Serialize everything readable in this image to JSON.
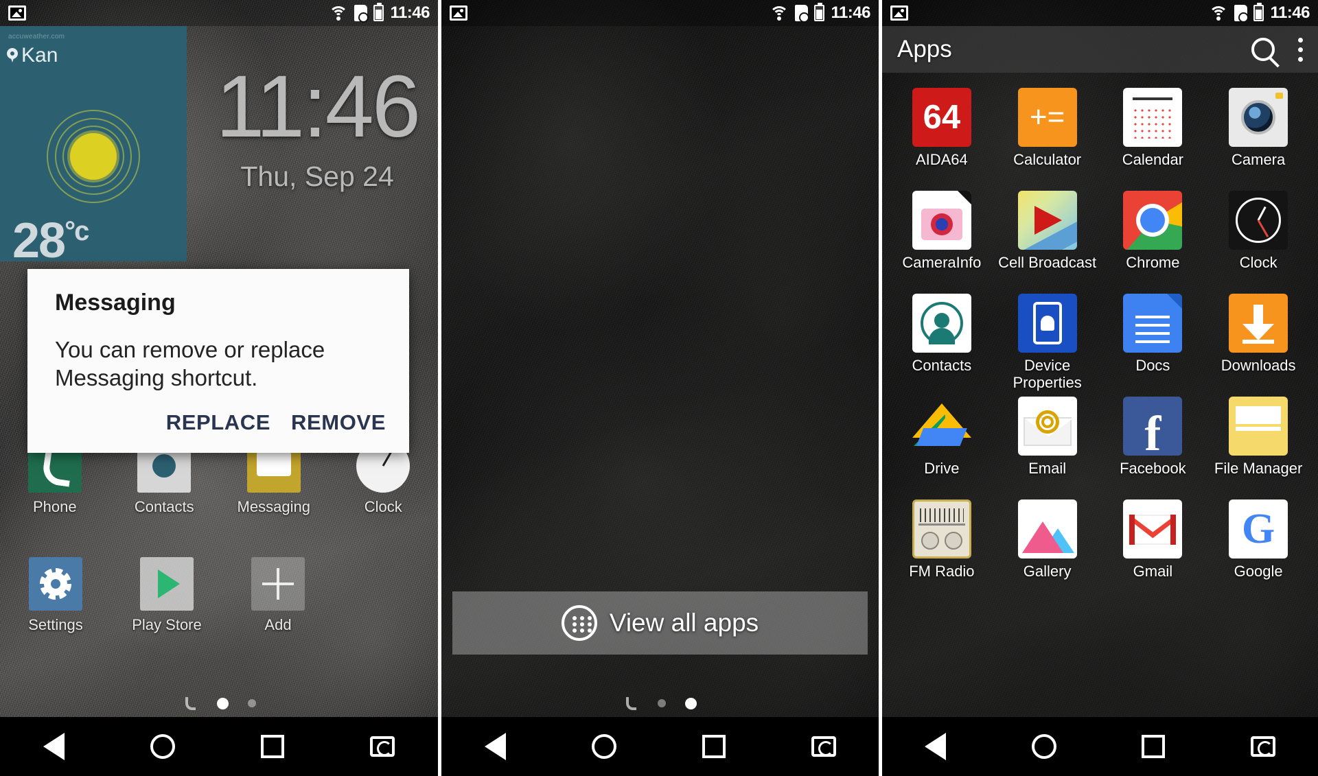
{
  "status_bar": {
    "time": "11:46",
    "icons": [
      "image-icon",
      "wifi-icon",
      "sim-icon",
      "battery-icon"
    ]
  },
  "panel1": {
    "widget": {
      "source": "accuweather.com",
      "location": "Kan",
      "temperature": "28",
      "unit": "°c",
      "condition_icon": "sun-icon"
    },
    "clock": {
      "time": "11:46",
      "date": "Thu, Sep 24"
    },
    "dialog": {
      "title": "Messaging",
      "message": "You can remove or replace Messaging shortcut.",
      "replace_label": "REPLACE",
      "remove_label": "REMOVE",
      "button_color": "#2a3550"
    },
    "dock_row": [
      {
        "label": "Phone",
        "icon": "phone-icon"
      },
      {
        "label": "Contacts",
        "icon": "contacts-icon"
      },
      {
        "label": "Messaging",
        "icon": "messaging-icon"
      },
      {
        "label": "Clock",
        "icon": "clock-icon"
      }
    ],
    "bottom_row": [
      {
        "label": "Settings",
        "icon": "gear-icon"
      },
      {
        "label": "Play Store",
        "icon": "play-store-icon"
      },
      {
        "label": "Add",
        "icon": "plus-icon"
      }
    ],
    "page_dots": {
      "count": 2,
      "active_index": 0
    }
  },
  "panel2": {
    "view_all_apps": {
      "label": "View all apps",
      "icon": "app-grid-icon"
    },
    "page_dots": {
      "count": 2,
      "active_index": 1
    }
  },
  "panel3": {
    "title": "Apps",
    "actions": [
      {
        "name": "search-icon"
      },
      {
        "name": "overflow-menu-icon"
      }
    ],
    "apps": [
      {
        "label": "AIDA64",
        "icon": "aida64-icon",
        "badge": "64"
      },
      {
        "label": "Calculator",
        "icon": "calculator-icon",
        "badge": "+="
      },
      {
        "label": "Calendar",
        "icon": "calendar-icon"
      },
      {
        "label": "Camera",
        "icon": "camera-icon"
      },
      {
        "label": "CameraInfo",
        "icon": "camerainfo-icon"
      },
      {
        "label": "Cell Broadcast",
        "icon": "cell-broadcast-icon"
      },
      {
        "label": "Chrome",
        "icon": "chrome-icon"
      },
      {
        "label": "Clock",
        "icon": "clock-icon"
      },
      {
        "label": "Contacts",
        "icon": "contacts-icon"
      },
      {
        "label": "Device Properties",
        "icon": "device-properties-icon"
      },
      {
        "label": "Docs",
        "icon": "docs-icon"
      },
      {
        "label": "Downloads",
        "icon": "downloads-icon"
      },
      {
        "label": "Drive",
        "icon": "drive-icon"
      },
      {
        "label": "Email",
        "icon": "email-icon",
        "badge": "@"
      },
      {
        "label": "Facebook",
        "icon": "facebook-icon",
        "badge": "f"
      },
      {
        "label": "File Manager",
        "icon": "file-manager-icon"
      },
      {
        "label": "FM Radio",
        "icon": "fm-radio-icon"
      },
      {
        "label": "Gallery",
        "icon": "gallery-icon"
      },
      {
        "label": "Gmail",
        "icon": "gmail-icon"
      },
      {
        "label": "Google",
        "icon": "google-icon",
        "badge": "G"
      }
    ]
  },
  "nav_bar": [
    {
      "name": "back-button",
      "icon": "back-triangle-icon"
    },
    {
      "name": "home-button",
      "icon": "home-circle-icon"
    },
    {
      "name": "recents-button",
      "icon": "recents-square-icon"
    },
    {
      "name": "rotate-button",
      "icon": "rotate-screen-icon"
    }
  ]
}
